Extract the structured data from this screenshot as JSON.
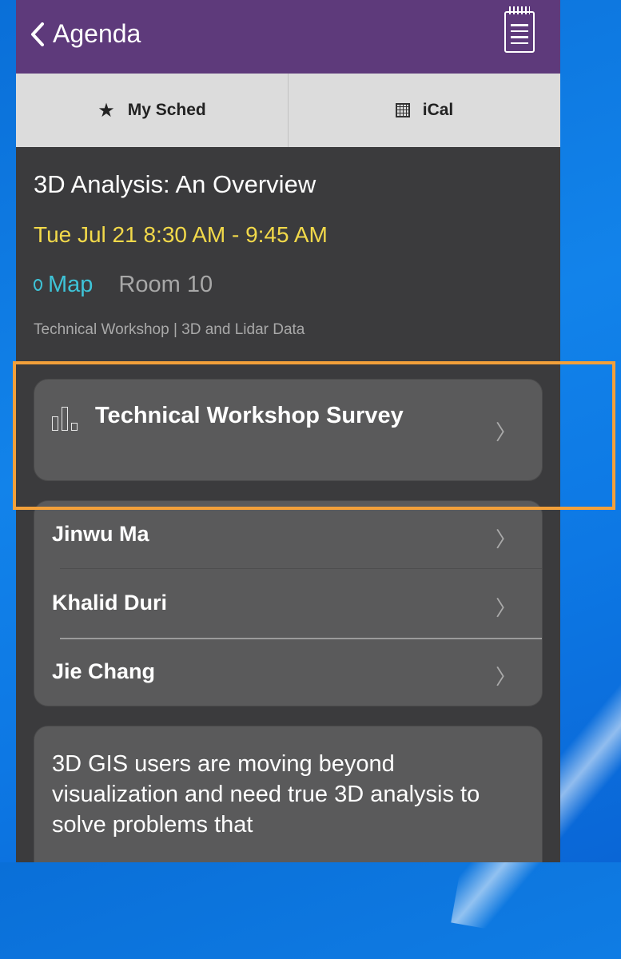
{
  "nav": {
    "back_label": "Agenda"
  },
  "toolbar": {
    "my_sched_label": "My Sched",
    "ical_label": "iCal"
  },
  "session": {
    "title": "3D Analysis: An Overview",
    "time": "Tue Jul 21 8:30 AM - 9:45 AM",
    "map_label": "Map",
    "room": "Room 10",
    "tags": "Technical Workshop | 3D and Lidar Data"
  },
  "survey": {
    "label": "Technical Workshop Survey"
  },
  "speakers": [
    "Jinwu Ma",
    "Khalid Duri",
    "Jie Chang"
  ],
  "description": "3D GIS users are moving beyond visualization and need true 3D analysis to solve problems that",
  "colors": {
    "nav": "#5e3a7b",
    "time": "#f2d94a",
    "map_link": "#3ec3d7",
    "highlight": "#f2a03a"
  }
}
